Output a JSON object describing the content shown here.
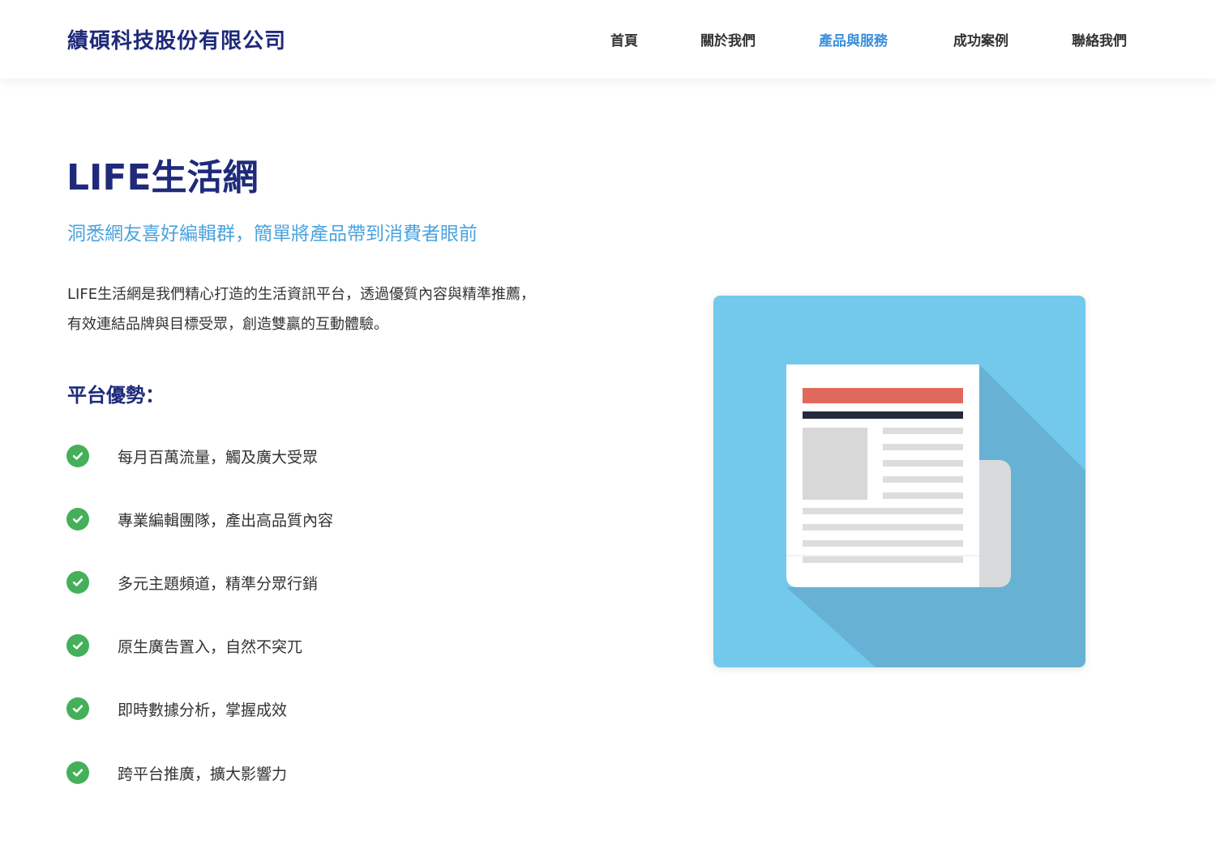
{
  "header": {
    "logo": "績碩科技股份有限公司",
    "nav": [
      {
        "label": "首頁",
        "active": false
      },
      {
        "label": "關於我們",
        "active": false
      },
      {
        "label": "產品與服務",
        "active": true
      },
      {
        "label": "成功案例",
        "active": false
      },
      {
        "label": "聯絡我們",
        "active": false
      }
    ]
  },
  "main": {
    "title": "LIFE生活網",
    "subtitle": "洞悉網友喜好編輯群，簡單將產品帶到消費者眼前",
    "description": [
      "LIFE生活網是我們精心打造的生活資訊平台，透過優質內容與精準推薦，",
      "有效連結品牌與目標受眾，創造雙贏的互動體驗。"
    ],
    "advantages_title": "平台優勢：",
    "advantages": [
      "每月百萬流量，觸及廣大受眾",
      "專業編輯團隊，產出高品質內容",
      "多元主題頻道，精準分眾行銷",
      "原生廣告置入，自然不突兀",
      "即時數據分析，掌握成效",
      "跨平台推廣，擴大影響力"
    ],
    "illustration_icon": "newspaper-icon"
  },
  "colors": {
    "brand_navy": "#1f2a7a",
    "accent_blue": "#3a8fdc",
    "subtitle_blue": "#4aa3de",
    "check_green": "#44b05a",
    "illustration_bg": "#72c9ec",
    "headline_red": "#e0695c"
  }
}
